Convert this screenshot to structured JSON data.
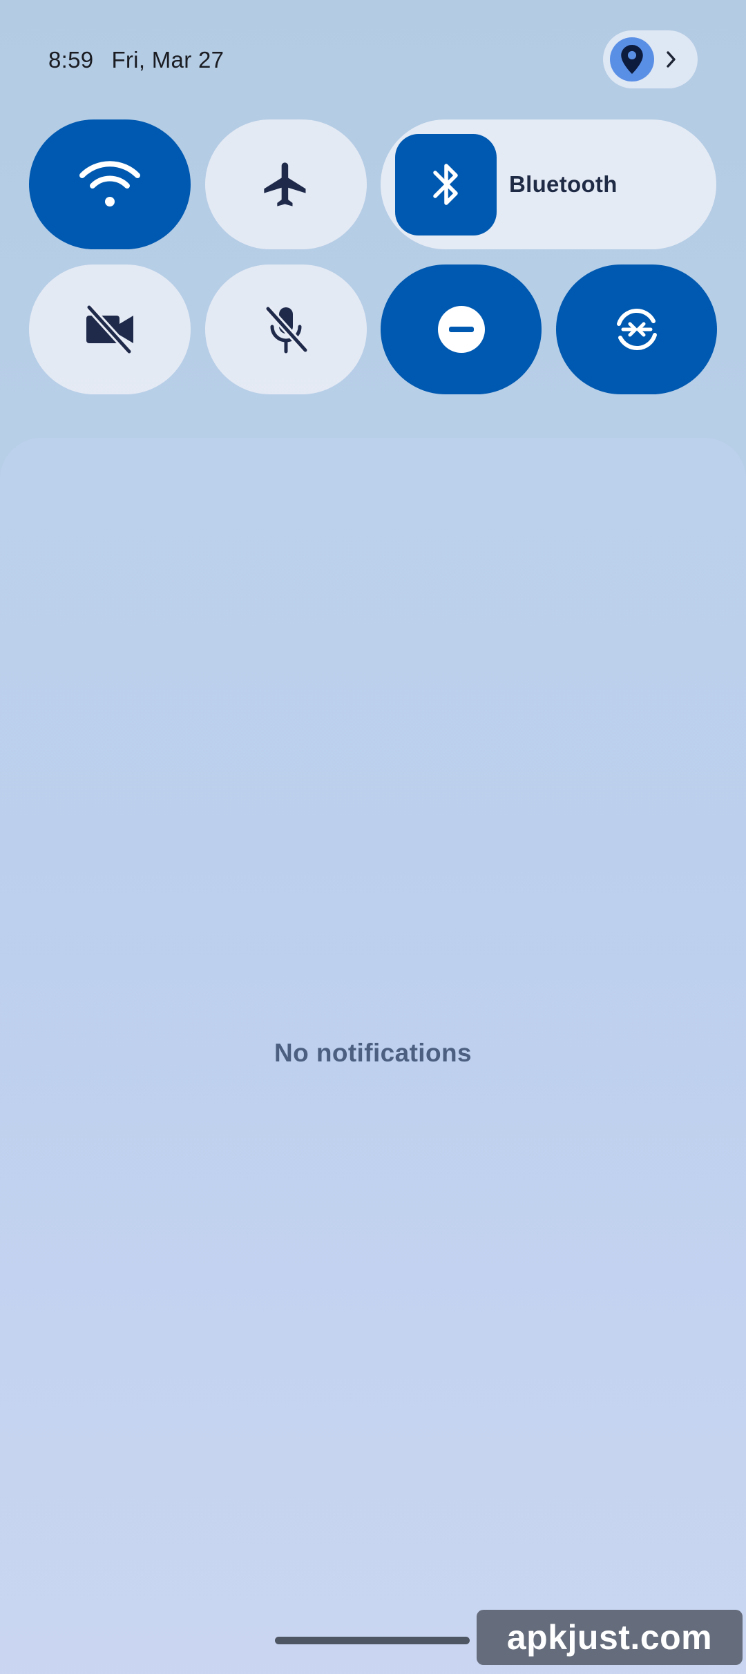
{
  "status": {
    "time": "8:59",
    "date": "Fri, Mar 27"
  },
  "location_chip": {
    "icon": "location-pin-icon",
    "chevron": "chevron-right-icon"
  },
  "quick_tiles": [
    {
      "name": "wifi",
      "icon": "wifi-icon",
      "state": "on"
    },
    {
      "name": "airplane-mode",
      "icon": "airplane-icon",
      "state": "off"
    },
    {
      "name": "bluetooth",
      "icon": "bluetooth-icon",
      "state": "on",
      "label": "Bluetooth"
    },
    {
      "name": "camera-access",
      "icon": "camera-off-icon",
      "state": "off"
    },
    {
      "name": "microphone-access",
      "icon": "mic-off-icon",
      "state": "off"
    },
    {
      "name": "do-not-disturb",
      "icon": "do-not-disturb-icon",
      "state": "on"
    },
    {
      "name": "data-saver",
      "icon": "sync-icon",
      "state": "on"
    }
  ],
  "notifications": {
    "empty_text": "No notifications"
  },
  "watermark": "apkjust.com",
  "colors": {
    "tile_on": "#0059b0",
    "tile_off": "#eaeef6",
    "icon_dark": "#1f2a4a"
  }
}
